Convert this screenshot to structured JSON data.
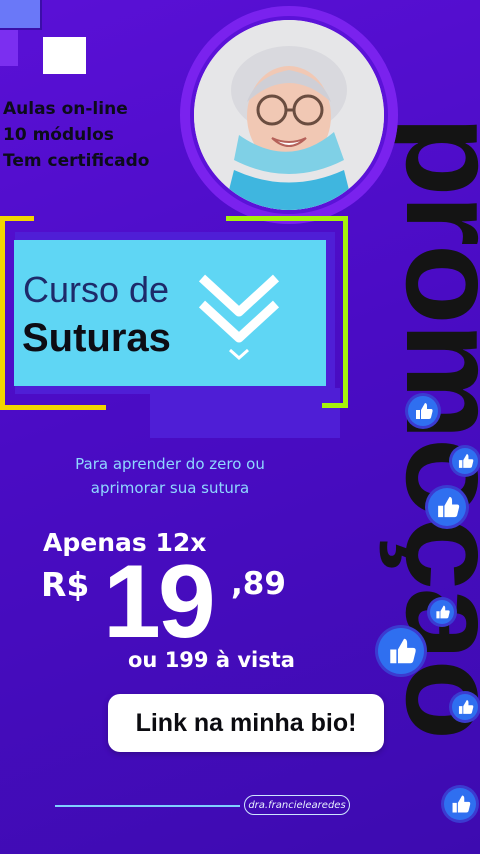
{
  "promo_word": "promoção",
  "features": [
    "Aulas on-line",
    "10 módulos",
    "Tem certificado"
  ],
  "course": {
    "title_line1": "Curso de",
    "title_line2": "Suturas"
  },
  "subtitle_lines": [
    "Para aprender do zero ou",
    "aprimorar sua sutura"
  ],
  "price": {
    "installments_label": "Apenas 12x",
    "currency": "R$",
    "integer": "19",
    "cents": ",89",
    "cash_line": "ou 199 à vista"
  },
  "cta_label": "Link na minha bio!",
  "handle": "dra.francielearedes",
  "colors": {
    "background": "#4a0cc4",
    "card": "#5fd6f4",
    "accent_yellow": "#f2d600",
    "accent_lime": "#a6f20a",
    "like_blue": "#2f6ff0"
  },
  "icons": [
    "double-chevron-down-icon",
    "thumbs-up-icon"
  ]
}
